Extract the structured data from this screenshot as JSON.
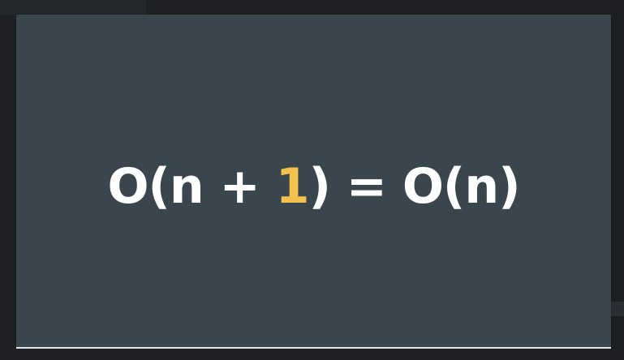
{
  "slide": {
    "formula": {
      "prefix": "O(n + ",
      "highlight": "1",
      "suffix": ") = O(n)"
    },
    "colors": {
      "background": "#39464d",
      "text": "#ffffff",
      "highlight": "#f2c14e",
      "frame": "#1e2023"
    }
  }
}
